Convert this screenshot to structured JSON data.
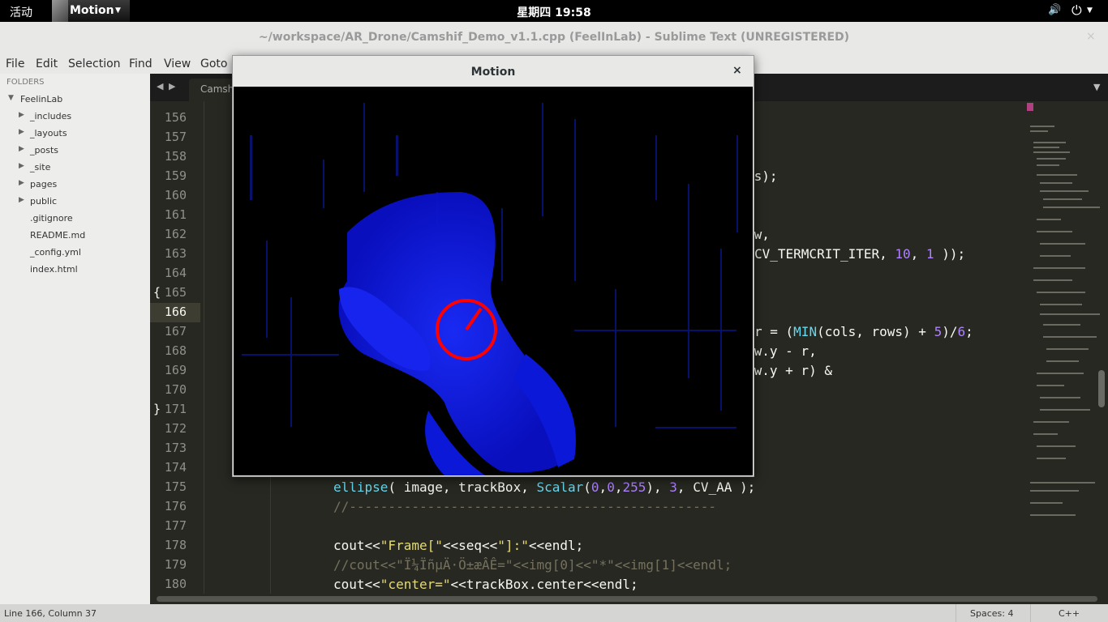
{
  "topbar": {
    "activities": "活动",
    "app_menu": "Motion",
    "clock": "星期四 19:58",
    "app_icon": "window-thumbnail-icon",
    "volume_icon": "volume-icon",
    "power_icon": "power-icon"
  },
  "window": {
    "title": "~/workspace/AR_Drone/Camshif_Demo_v1.1.cpp (FeelInLab) - Sublime Text (UNREGISTERED)",
    "close_icon": "×"
  },
  "menubar": [
    "File",
    "Edit",
    "Selection",
    "Find",
    "View",
    "Goto"
  ],
  "sidebar": {
    "header": "FOLDERS",
    "root": "FeelinLab",
    "folders": [
      "_includes",
      "_layouts",
      "_posts",
      "_site",
      "pages",
      "public"
    ],
    "files": [
      ".gitignore",
      "README.md",
      "_config.yml",
      "index.html"
    ]
  },
  "tabs": {
    "prev": "◀",
    "next": "▶",
    "active": "Camshif",
    "overflow": "▼"
  },
  "editor": {
    "line_numbers": [
      "156",
      "157",
      "158",
      "159",
      "160",
      "161",
      "162",
      "163",
      "164",
      "165",
      "166",
      "167",
      "168",
      "169",
      "170",
      "171",
      "172",
      "173",
      "174",
      "175",
      "176",
      "177",
      "178",
      "179",
      "180"
    ],
    "current_line": "166",
    "fold_open": "{",
    "fold_close": "}",
    "visible_code": {
      "l159": "es);",
      "l162": "ow,",
      "l163_a": "CV_TERMCRIT_ITER, ",
      "l163_b": "10",
      "l163_c": ", ",
      "l163_d": "1",
      "l163_e": " ));",
      "l167_a": "r = (",
      "l167_b": "MIN",
      "l167_c": "(cols, rows) + ",
      "l167_d": "5",
      "l167_e": ")/",
      "l167_f": "6",
      "l167_g": ";",
      "l168": "ow.y - r,",
      "l169": "ow.y + r) &",
      "l175_a": "ellipse",
      "l175_b": "( image, trackBox, ",
      "l175_c": "Scalar",
      "l175_d": "(",
      "l175_e": "0",
      "l175_f": ",",
      "l175_g": "0",
      "l175_h": ",",
      "l175_i": "255",
      "l175_j": "), ",
      "l175_k": "3",
      "l175_l": ", CV_AA );",
      "l176": "//-----------------------------------------------",
      "l178_a": "cout<<",
      "l178_b": "\"Frame[\"",
      "l178_c": "<<seq<<",
      "l178_d": "\"]:\"",
      "l178_e": "<<endl;",
      "l179": "//cout<<\"Ï¼ÏñµÄ·Ö±æÂÊ=\"<<img[0]<<\"*\"<<img[1]<<endl;",
      "l180_a": "cout<<",
      "l180_b": "\"center=\"",
      "l180_c": "<<trackBox.center<<endl;"
    }
  },
  "statusbar": {
    "position": "Line 166, Column 37",
    "spaces": "Spaces: 4",
    "syntax": "C++"
  },
  "motion_window": {
    "title": "Motion",
    "close": "×"
  },
  "colors": {
    "editor_bg": "#272822",
    "motion_blue": "#0a14ff",
    "track_ellipse": "#ff0000"
  }
}
